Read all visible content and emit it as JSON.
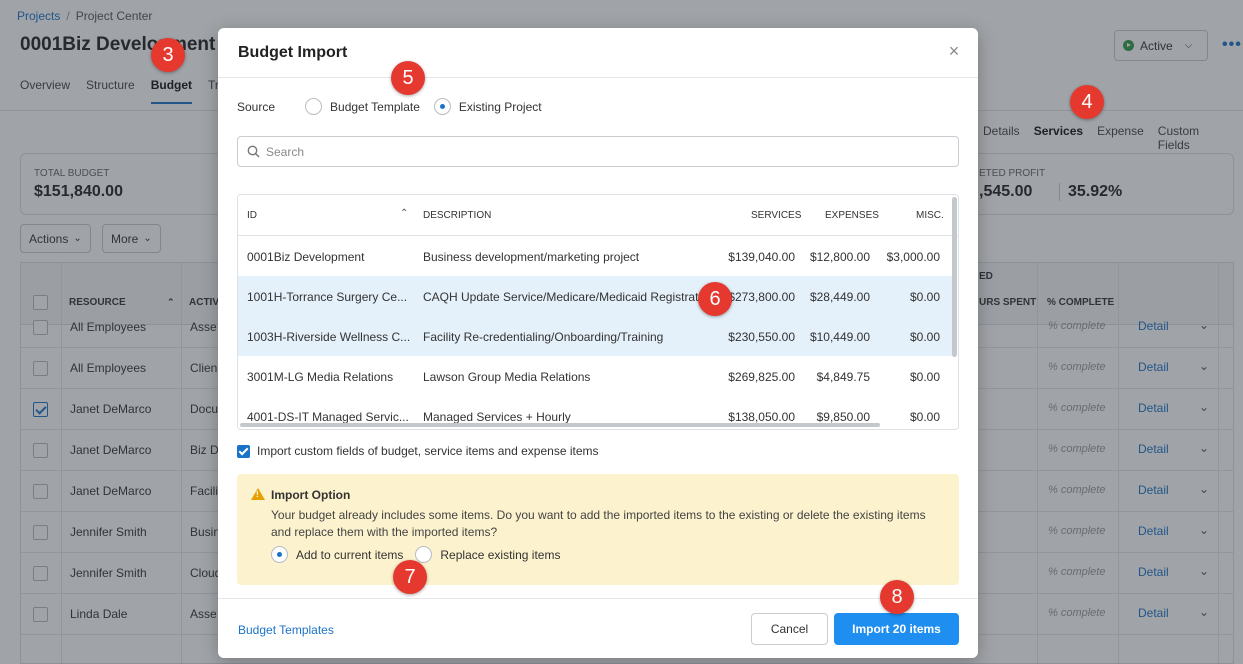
{
  "breadcrumb": {
    "projects": "Projects",
    "sep": "/",
    "current": "Project Center"
  },
  "page_title": "0001Biz Development",
  "tabs": [
    "Overview",
    "Structure",
    "Budget",
    "Tr"
  ],
  "status": {
    "label": "Active",
    "color": "#2e9d45"
  },
  "more_icon": "•••",
  "subtabs": [
    "Details",
    "Services",
    "Expense",
    "Custom Fields"
  ],
  "summary": {
    "total_budget_label": "TOTAL BUDGET",
    "total_budget_value": "$151,840.00",
    "profit_label": "ETED PROFIT",
    "profit_value": ",545.00",
    "profit_pct": "35.92%"
  },
  "actions": {
    "actions_label": "Actions",
    "more_label": "More"
  },
  "grid": {
    "headers": {
      "resource": "RESOURCE",
      "activity": "ACTIV",
      "hours": "URS SPENT",
      "group": "ED",
      "pct": "% COMPLETE"
    },
    "rows": [
      {
        "resource": "All Employees",
        "activity": "Asse",
        "checked": false,
        "pct": "% complete",
        "detail": "Detail"
      },
      {
        "resource": "All Employees",
        "activity": "Clien",
        "checked": false,
        "pct": "% complete",
        "detail": "Detail"
      },
      {
        "resource": "Janet DeMarco",
        "activity": "Docu",
        "checked": true,
        "pct": "% complete",
        "detail": "Detail"
      },
      {
        "resource": "Janet DeMarco",
        "activity": "Biz D",
        "checked": false,
        "pct": "% complete",
        "detail": "Detail"
      },
      {
        "resource": "Janet DeMarco",
        "activity": "Facili",
        "checked": false,
        "pct": "% complete",
        "detail": "Detail"
      },
      {
        "resource": "Jennifer Smith",
        "activity": "Busin",
        "checked": false,
        "pct": "% complete",
        "detail": "Detail"
      },
      {
        "resource": "Jennifer Smith",
        "activity": "Cloud",
        "checked": false,
        "pct": "% complete",
        "detail": "Detail"
      },
      {
        "resource": "Linda Dale",
        "activity": "Asse",
        "checked": false,
        "pct": "% complete",
        "detail": "Detail"
      }
    ]
  },
  "modal": {
    "title": "Budget Import",
    "close_icon": "×",
    "source_label": "Source",
    "source_options": [
      {
        "label": "Budget Template",
        "selected": false
      },
      {
        "label": "Existing Project",
        "selected": true
      }
    ],
    "search_placeholder": "Search",
    "table": {
      "headers": {
        "id": "ID",
        "description": "DESCRIPTION",
        "services": "SERVICES",
        "expenses": "EXPENSES",
        "misc": "MISC."
      },
      "sort_icon": "^",
      "rows": [
        {
          "id": "0001Biz Development",
          "description": "Business development/marketing project",
          "services": "$139,040.00",
          "expenses": "$12,800.00",
          "misc": "$3,000.00",
          "selected": false
        },
        {
          "id": "1001H-Torrance Surgery Ce...",
          "description": "CAQH Update Service/Medicare/Medicaid Registratio",
          "services": "$273,800.00",
          "expenses": "$28,449.00",
          "misc": "$0.00",
          "selected": true
        },
        {
          "id": "1003H-Riverside Wellness C...",
          "description": "Facility Re-credentialing/Onboarding/Training",
          "services": "$230,550.00",
          "expenses": "$10,449.00",
          "misc": "$0.00",
          "selected": true
        },
        {
          "id": "3001M-LG Media Relations",
          "description": "Lawson Group Media Relations",
          "services": "$269,825.00",
          "expenses": "$4,849.75",
          "misc": "$0.00",
          "selected": false
        },
        {
          "id": "4001-DS-IT Managed Servic...",
          "description": "Managed Services + Hourly",
          "services": "$138,050.00",
          "expenses": "$9,850.00",
          "misc": "$0.00",
          "selected": false
        }
      ]
    },
    "import_custom_label": "Import custom fields of budget, service items and expense items",
    "import_option": {
      "title": "Import Option",
      "text": "Your budget already includes some items. Do you want to add the imported items to the existing or delete the existing items and replace them with the imported items?",
      "options": [
        {
          "label": "Add to current items",
          "selected": true
        },
        {
          "label": "Replace existing items",
          "selected": false
        }
      ]
    },
    "footer": {
      "templates_link": "Budget Templates",
      "cancel_label": "Cancel",
      "import_label": "Import 20 items"
    }
  },
  "steps": [
    "3",
    "4",
    "5",
    "6",
    "7",
    "8"
  ],
  "colors": {
    "accent": "#1a73c8",
    "primary_button": "#1e8ff0",
    "warning_bg": "#fcf2cd",
    "step_marker": "#e5392f",
    "selected_row": "#e4f0fa"
  }
}
